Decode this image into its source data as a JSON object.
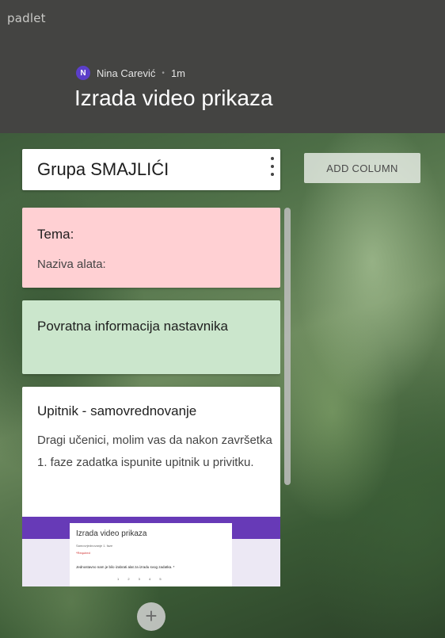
{
  "app": {
    "logo": "padlet"
  },
  "header": {
    "author_initial": "N",
    "author_name": "Nina Carević",
    "separator": "•",
    "time_ago": "1m",
    "title": "Izrada video prikaza"
  },
  "column": {
    "title": "Grupa SMAJLIĆI"
  },
  "add_column_label": "ADD COLUMN",
  "cards": [
    {
      "title": "Tema:",
      "body": "Naziva alata:",
      "color": "#ffd0d3"
    },
    {
      "title": "Povratna informacija nastavnika",
      "body": "",
      "color": "#cbe6cc"
    },
    {
      "title": "Upitnik - samovrednovanje",
      "body": "Dragi učenici, molim vas da nakon završetka 1. faze zadatka ispunite upitnik u privitku.",
      "color": "#ffffff",
      "attachment": {
        "title": "Izrada video prikaza",
        "subtitle": "Samovrjednovanje 1. faze",
        "required": "*Required",
        "question": "Jednostavno nam je bilo izabrati alat za izradu svog zadatka. *",
        "scale": "1 2 3 4 5"
      }
    }
  ],
  "add_post_label": "+",
  "colors": {
    "header_bg": "#444442",
    "avatar": "#5b3fc9",
    "form_accent": "#673ab7"
  }
}
